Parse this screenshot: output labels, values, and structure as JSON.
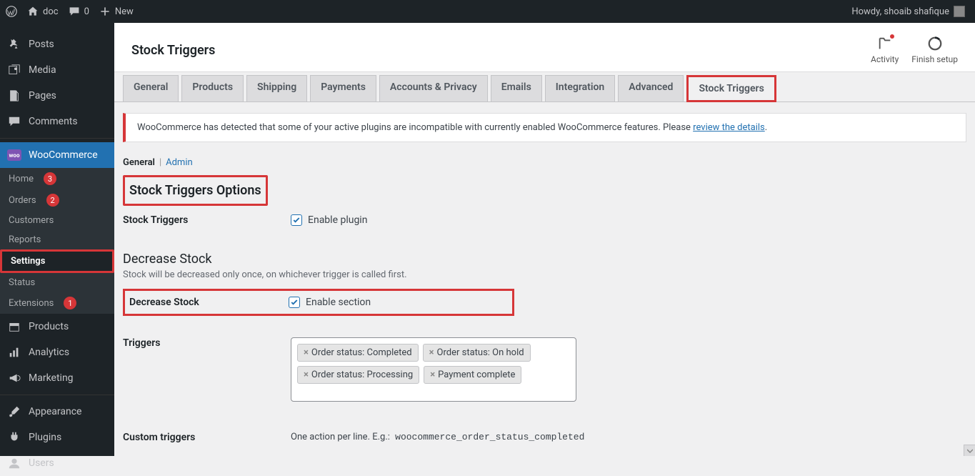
{
  "adminbar": {
    "site": "doc",
    "comments": "0",
    "new": "New",
    "howdy": "Howdy, shoaib shafique"
  },
  "sidebar": {
    "posts": "Posts",
    "media": "Media",
    "pages": "Pages",
    "comments": "Comments",
    "woocommerce": "WooCommerce",
    "sub": {
      "home": "Home",
      "home_badge": "3",
      "orders": "Orders",
      "orders_badge": "2",
      "customers": "Customers",
      "reports": "Reports",
      "settings": "Settings",
      "status": "Status",
      "extensions": "Extensions",
      "extensions_badge": "1"
    },
    "products": "Products",
    "analytics": "Analytics",
    "marketing": "Marketing",
    "appearance": "Appearance",
    "plugins": "Plugins",
    "users": "Users"
  },
  "header": {
    "title": "Stock Triggers",
    "activity": "Activity",
    "finish": "Finish setup"
  },
  "tabs": {
    "general": "General",
    "products": "Products",
    "shipping": "Shipping",
    "payments": "Payments",
    "accounts": "Accounts & Privacy",
    "emails": "Emails",
    "integration": "Integration",
    "advanced": "Advanced",
    "stock_triggers": "Stock Triggers"
  },
  "notice": {
    "text": "WooCommerce has detected that some of your active plugins are incompatible with currently enabled WooCommerce features. Please ",
    "link": "review the details",
    "tail": "."
  },
  "subnav": {
    "general": "General",
    "admin": "Admin"
  },
  "section1_title": "Stock Triggers Options",
  "row_stock_triggers": {
    "label": "Stock Triggers",
    "check": "Enable plugin"
  },
  "section2_title": "Decrease Stock",
  "section2_desc": "Stock will be decreased only once, on whichever trigger is called first.",
  "row_decrease": {
    "label": "Decrease Stock",
    "check": "Enable section"
  },
  "row_triggers": {
    "label": "Triggers",
    "tags": [
      "Order status: Completed",
      "Order status: On hold",
      "Order status: Processing",
      "Payment complete"
    ]
  },
  "row_custom": {
    "label": "Custom triggers",
    "hint_pre": "One action per line. E.g.: ",
    "code": "woocommerce_order_status_completed"
  }
}
